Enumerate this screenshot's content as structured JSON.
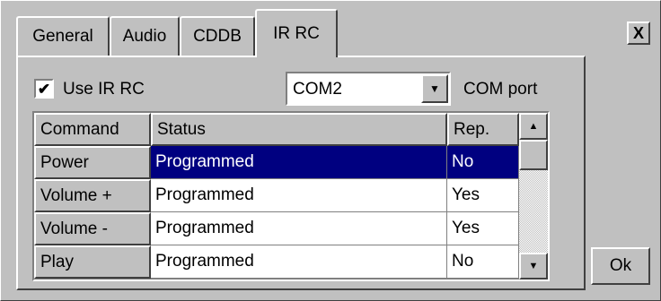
{
  "tabs": [
    {
      "label": "General"
    },
    {
      "label": "Audio"
    },
    {
      "label": "CDDB"
    },
    {
      "label": "IR RC"
    }
  ],
  "active_tab": "IR RC",
  "use_ir_rc": {
    "label": "Use IR RC",
    "checked": true,
    "mark": "✔"
  },
  "com_port": {
    "value": "COM2",
    "label": "COM port"
  },
  "table": {
    "headers": [
      "Command",
      "Status",
      "Rep."
    ],
    "rows": [
      {
        "command": "Power",
        "status": "Programmed",
        "rep": "No",
        "selected": true
      },
      {
        "command": "Volume +",
        "status": "Programmed",
        "rep": "Yes",
        "selected": false
      },
      {
        "command": "Volume -",
        "status": "Programmed",
        "rep": "Yes",
        "selected": false
      },
      {
        "command": "Play",
        "status": "Programmed",
        "rep": "No",
        "selected": false
      }
    ]
  },
  "buttons": {
    "close": "X",
    "ok": "Ok"
  },
  "icons": {
    "up": "up-arrow-icon",
    "down": "down-arrow-icon",
    "dropdown": "dropdown-arrow-icon"
  },
  "colors": {
    "selection": "#000080",
    "face": "#c0c0c0"
  }
}
